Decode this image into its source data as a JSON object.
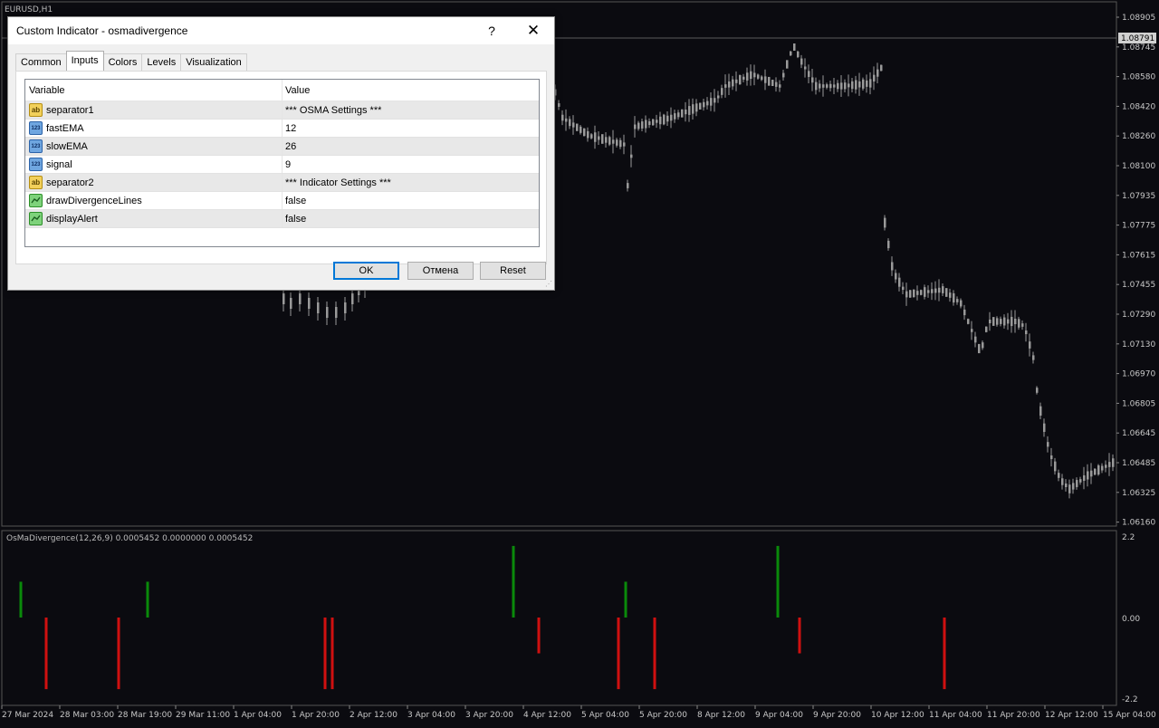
{
  "chart": {
    "symbol_label": "EURUSD,H1",
    "current_price": "1.08791",
    "price_axis": [
      "1.08905",
      "1.08745",
      "1.08580",
      "1.08420",
      "1.08260",
      "1.08100",
      "1.07935",
      "1.07775",
      "1.07615",
      "1.07455",
      "1.07290",
      "1.07130",
      "1.06970",
      "1.06805",
      "1.06645",
      "1.06485",
      "1.06325",
      "1.06160"
    ],
    "time_axis": [
      "27 Mar 2024",
      "28 Mar 03:00",
      "28 Mar 19:00",
      "29 Mar 11:00",
      "1 Apr 04:00",
      "1 Apr 20:00",
      "2 Apr 12:00",
      "3 Apr 04:00",
      "3 Apr 20:00",
      "4 Apr 12:00",
      "5 Apr 04:00",
      "5 Apr 20:00",
      "8 Apr 12:00",
      "9 Apr 04:00",
      "9 Apr 20:00",
      "10 Apr 12:00",
      "11 Apr 04:00",
      "11 Apr 20:00",
      "12 Apr 12:00",
      "15 Apr 04:00"
    ],
    "colors": {
      "background": "#0b0b10",
      "candles": "#9a9a9a",
      "bullish_bar": "#0a8a0a",
      "bearish_bar": "#d01010",
      "axis_text": "#c8c8c8"
    }
  },
  "indicator": {
    "label": "OsMaDivergence(12,26,9) 0.0005452 0.0000000 0.0005452",
    "scale": [
      "2.2",
      "0.00",
      "-2.2"
    ]
  },
  "dialog": {
    "title": "Custom Indicator - osmadivergence",
    "help_label": "?",
    "close_label": "✕",
    "tabs": [
      "Common",
      "Inputs",
      "Colors",
      "Levels",
      "Visualization"
    ],
    "active_tab": "Inputs",
    "columns": [
      "Variable",
      "Value"
    ],
    "rows": [
      {
        "icon": "ab",
        "variable": "separator1",
        "value": "*** OSMA Settings ***"
      },
      {
        "icon": "123",
        "variable": "fastEMA",
        "value": "12"
      },
      {
        "icon": "123",
        "variable": "slowEMA",
        "value": "26"
      },
      {
        "icon": "123",
        "variable": "signal",
        "value": "9"
      },
      {
        "icon": "ab",
        "variable": "separator2",
        "value": "*** Indicator Settings ***"
      },
      {
        "icon": "bool",
        "variable": "drawDivergenceLines",
        "value": "false"
      },
      {
        "icon": "bool",
        "variable": "displayAlert",
        "value": "false"
      }
    ],
    "buttons": {
      "ok": "OK",
      "cancel": "Отмена",
      "reset": "Reset"
    }
  }
}
